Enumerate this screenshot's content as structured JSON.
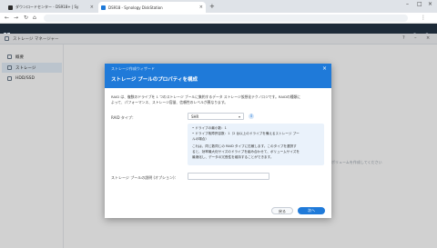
{
  "browser": {
    "tabs": [
      {
        "label": "ダウンロードセンター - DS918+ | Sy"
      },
      {
        "label": "DS918 - Synology DiskStation"
      }
    ],
    "new_tab": "+"
  },
  "app": {
    "title": "ストレージ マネージャー"
  },
  "sidebar": {
    "items": [
      {
        "label": "概要"
      },
      {
        "label": "ストレージ"
      },
      {
        "label": "HDD/SSD"
      }
    ]
  },
  "background_note": "ボリュームを作成してください",
  "dialog": {
    "wizard_label": "ストレージ作成ウィザード",
    "title": "ストレージ プールのプロパティを構成",
    "description_lines": [
      "RAID は、複数のドライブを 1 つのストレージ プールに集約するデータ ストレージ仮想化テクノロジです。RAIDの種類に",
      "よって、パフォーマンス、ストレージ容量、信頼性のレベルが異なります。"
    ],
    "raid_label": "RAID タイプ：",
    "raid_value": "SHR",
    "info_lines": [
      "• ドライブの最小数：1",
      "• ドライブ故障許容数：1（2 台以上のドライブを備えるストレージ プー",
      "   ルの場合）",
      "これは、同じ数同じの RAID タイプに匹敵します。このタイプを選択す",
      "ると、効率最大化サイズのドライブを組み合わせて、ボリュームサイズを",
      "最適化し、データの冗長性を維持することができます。"
    ],
    "optional_label": "ストレージ プールの説明 (オプション)：",
    "optional_value": "",
    "back_button": "戻る",
    "next_button": "次へ"
  },
  "colors": {
    "accent": "#1f7ad9",
    "dsm_bar": "#1d2a38",
    "info_bg": "#eaf2fb"
  }
}
